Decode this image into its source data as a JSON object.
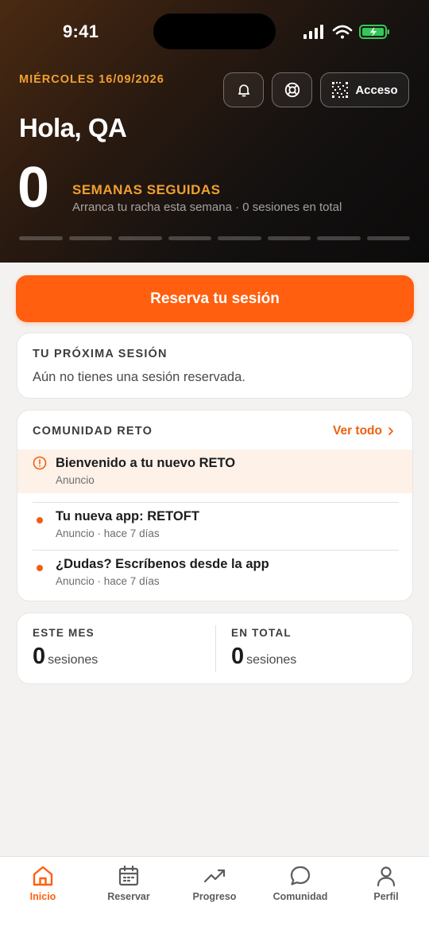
{
  "status_bar": {
    "time": "9:41"
  },
  "header": {
    "date": "MIÉRCOLES 16/09/2026",
    "greeting": "Hola, QA",
    "access_label": "Acceso",
    "streak": {
      "count": "0",
      "label": "SEMANAS SEGUIDAS",
      "subtitle": "Arranca tu racha esta semana · 0 sesiones en total",
      "weeks_completed": 0,
      "weeks_total": 8
    }
  },
  "cta": {
    "label": "Reserva tu sesión"
  },
  "next_session": {
    "label": "TU PRÓXIMA SESIÓN",
    "text": "Aún no tienes una sesión reservada."
  },
  "community": {
    "label": "COMUNIDAD RETO",
    "see_all": "Ver todo",
    "posts": [
      {
        "title": "Bienvenido a tu nuevo RETO",
        "meta": "Anuncio",
        "icon": "alert-circle-icon"
      },
      {
        "title": "Tu nueva app: RETOFT",
        "meta": "Anuncio · hace 7 días"
      },
      {
        "title": "¿Dudas? Escríbenos desde la app",
        "meta": "Anuncio · hace 7 días"
      }
    ]
  },
  "stats": {
    "month": {
      "label": "ESTE MES",
      "value": "0",
      "unit": "sesiones"
    },
    "total": {
      "label": "EN TOTAL",
      "value": "0",
      "unit": "sesiones"
    }
  },
  "tabbar": {
    "active": "Inicio",
    "items": [
      {
        "label": "Inicio",
        "icon": "home-icon"
      },
      {
        "label": "Reservar",
        "icon": "calendar-icon"
      },
      {
        "label": "Progreso",
        "icon": "trending-up-icon"
      },
      {
        "label": "Comunidad",
        "icon": "chat-bubble-icon"
      },
      {
        "label": "Perfil",
        "icon": "user-icon"
      }
    ]
  },
  "colors": {
    "accent": "#ff5f0f",
    "accent_text": "#f06010",
    "header_gold": "#f0a030",
    "battery_green": "#34c759"
  }
}
